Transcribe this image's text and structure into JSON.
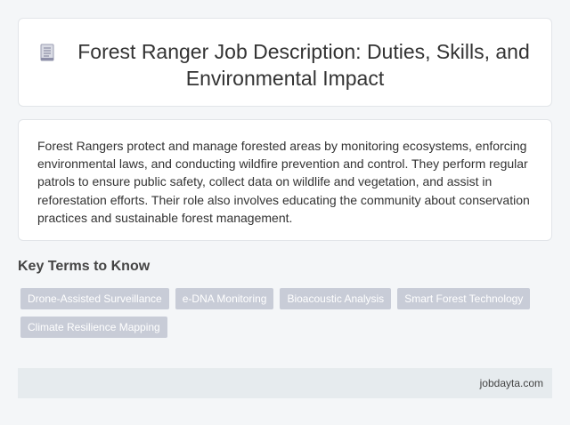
{
  "header": {
    "title": "Forest Ranger Job Description: Duties, Skills, and Environmental Impact",
    "icon": "document-icon"
  },
  "description": {
    "text": "Forest Rangers protect and manage forested areas by monitoring ecosystems, enforcing environmental laws, and conducting wildfire prevention and control. They perform regular patrols to ensure public safety, collect data on wildlife and vegetation, and assist in reforestation efforts. Their role also involves educating the community about conservation practices and sustainable forest management."
  },
  "key_terms": {
    "heading": "Key Terms to Know",
    "tags": [
      "Drone-Assisted Surveillance",
      "e-DNA Monitoring",
      "Bioacoustic Analysis",
      "Smart Forest Technology",
      "Climate Resilience Mapping"
    ]
  },
  "footer": {
    "site": "jobdayta.com"
  },
  "colors": {
    "background": "#f4f6f8",
    "tag": "#c8ccd7",
    "footer": "#e6ebee"
  }
}
